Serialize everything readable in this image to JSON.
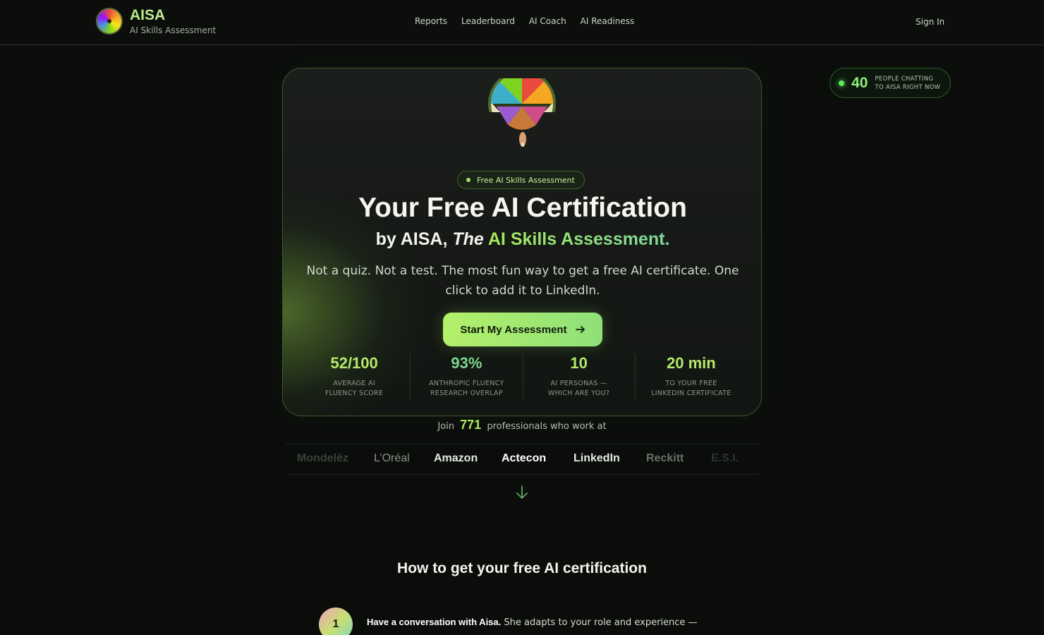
{
  "header": {
    "brand": "AISA",
    "brand_sub": "AI Skills Assessment",
    "nav": [
      "Reports",
      "Leaderboard",
      "AI Coach",
      "AI Readiness"
    ],
    "sign_in": "Sign In"
  },
  "live": {
    "count": "40",
    "line1": "PEOPLE CHATTING",
    "line2": "TO AISA RIGHT NOW"
  },
  "hero": {
    "tag": "Free AI Skills Assessment",
    "title": "Your Free AI Certification",
    "sub_prefix": "by AISA, ",
    "sub_the": "The",
    "sub_highlight": "AI Skills Assessment.",
    "description": "Not a quiz. Not a test. The most fun way to get a free AI certificate. One click to add it to LinkedIn.",
    "cta": "Start My Assessment",
    "stats": [
      {
        "value": "52/100",
        "label1": "AVERAGE AI",
        "label2": "FLUENCY SCORE"
      },
      {
        "value": "93%",
        "label1": "ANTHROPIC FLUENCY",
        "label2": "RESEARCH OVERLAP"
      },
      {
        "value": "10",
        "label1": "AI PERSONAS —",
        "label2": "WHICH ARE YOU?"
      },
      {
        "value": "20 min",
        "label1": "TO YOUR FREE",
        "label2": "LINKEDIN CERTIFICATE"
      }
    ]
  },
  "join": {
    "prefix": "Join",
    "count": "771",
    "suffix": "professionals who work at"
  },
  "companies": [
    "Mondelēz",
    "L’Oréal",
    "Amazon",
    "Actecon",
    "LinkedIn",
    "Reckitt",
    "E.S.I."
  ],
  "how": {
    "title": "How to get your free AI certification",
    "step1_num": "1",
    "step1_bold": "Have a conversation with Aisa.",
    "step1_text": " She adapts to your role and experience —"
  },
  "colors": {
    "accent": "#a6ea5a",
    "background": "#0b0d0b"
  }
}
